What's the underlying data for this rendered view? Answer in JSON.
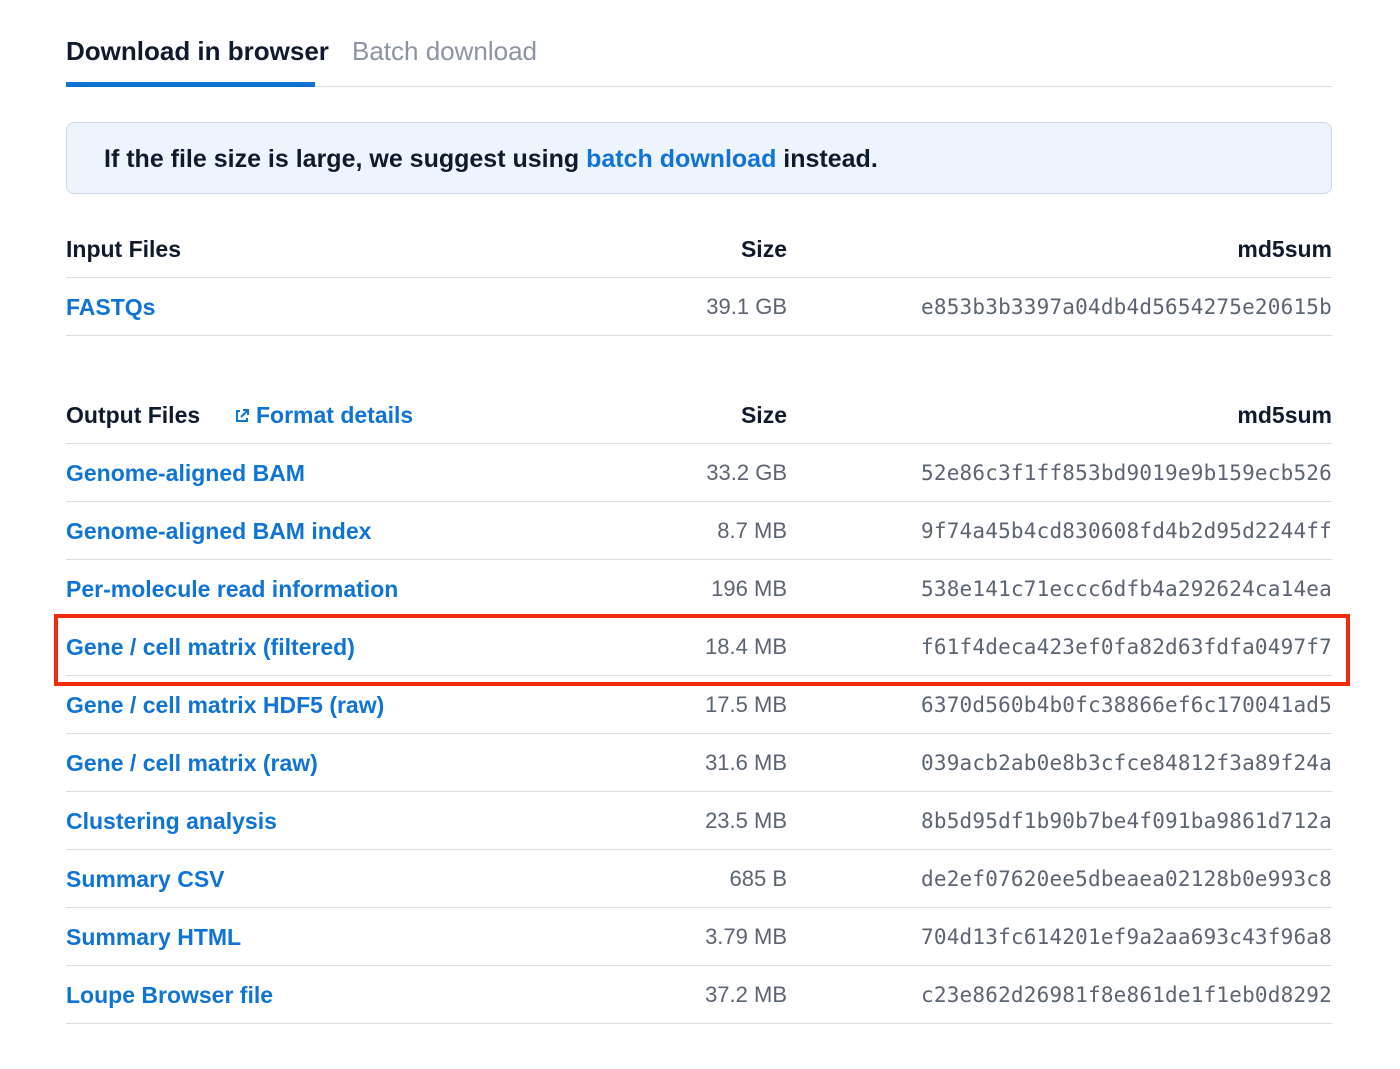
{
  "tabs": [
    {
      "label": "Download in browser",
      "active": true
    },
    {
      "label": "Batch download",
      "active": false
    }
  ],
  "notice": {
    "prefix": "If the file size is large, we suggest using ",
    "link": "batch download",
    "suffix": " instead."
  },
  "input_table": {
    "headers": {
      "name": "Input Files",
      "size": "Size",
      "md5": "md5sum"
    },
    "rows": [
      {
        "name": "FASTQs",
        "size": "39.1 GB",
        "md5": "e853b3b3397a04db4d5654275e20615b"
      }
    ]
  },
  "output_table": {
    "headers": {
      "name": "Output Files",
      "format_link": "Format details",
      "size": "Size",
      "md5": "md5sum"
    },
    "rows": [
      {
        "name": "Genome-aligned BAM",
        "size": "33.2 GB",
        "md5": "52e86c3f1ff853bd9019e9b159ecb526"
      },
      {
        "name": "Genome-aligned BAM index",
        "size": "8.7 MB",
        "md5": "9f74a45b4cd830608fd4b2d95d2244ff"
      },
      {
        "name": "Per-molecule read information",
        "size": "196 MB",
        "md5": "538e141c71eccc6dfb4a292624ca14ea"
      },
      {
        "name": "Gene / cell matrix (filtered)",
        "size": "18.4 MB",
        "md5": "f61f4deca423ef0fa82d63fdfa0497f7"
      },
      {
        "name": "Gene / cell matrix HDF5 (raw)",
        "size": "17.5 MB",
        "md5": "6370d560b4b0fc38866ef6c170041ad5"
      },
      {
        "name": "Gene / cell matrix (raw)",
        "size": "31.6 MB",
        "md5": "039acb2ab0e8b3cfce84812f3a89f24a"
      },
      {
        "name": "Clustering analysis",
        "size": "23.5 MB",
        "md5": "8b5d95df1b90b7be4f091ba9861d712a"
      },
      {
        "name": "Summary CSV",
        "size": "685 B",
        "md5": "de2ef07620ee5dbeaea02128b0e993c8"
      },
      {
        "name": "Summary HTML",
        "size": "3.79 MB",
        "md5": "704d13fc614201ef9a2aa693c43f96a8"
      },
      {
        "name": "Loupe Browser file",
        "size": "37.2 MB",
        "md5": "c23e862d26981f8e861de1f1eb0d8292"
      }
    ]
  },
  "highlight": {
    "row": "Gene / cell matrix (filtered)",
    "color": "#f22a0c"
  },
  "colors": {
    "accent": "#0f74d6",
    "text": "#0f1b2d",
    "muted": "#5b6472",
    "notice_bg": "#edf4fd"
  },
  "icons": {
    "format_details": "external-link-icon"
  }
}
